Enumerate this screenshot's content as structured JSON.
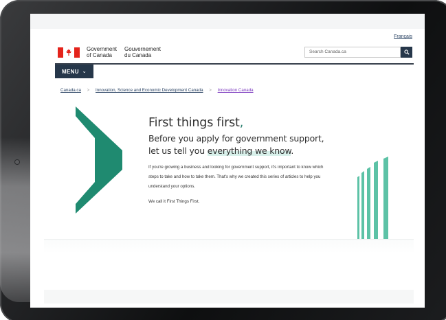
{
  "header": {
    "language_link": "Français",
    "brand_en_line1": "Government",
    "brand_en_line2": "of Canada",
    "brand_fr_line1": "Gouvernement",
    "brand_fr_line2": "du Canada",
    "search_placeholder": "Search Canada.ca",
    "menu_label": "MENU"
  },
  "breadcrumb": [
    "Canada.ca",
    "Innovation, Science and Economic Development Canada",
    "Innovation Canada"
  ],
  "hero": {
    "title": "First things first",
    "title_punct": ",",
    "subtitle_line1": "Before you apply for government support,",
    "subtitle_line2_prefix": "let us tell you ",
    "subtitle_line2_highlight": "everything we know",
    "subtitle_line2_suffix": ".",
    "body": "If you're growing a business and looking for government support, it's important to know which steps to take and how to take them. That's why we created this series of articles to help you understand your options.",
    "call_line": "We call it First Things First."
  },
  "colors": {
    "accent_teal": "#1f8a70",
    "bar_teal": "#5cc2a6",
    "navy": "#26374a",
    "flag_red": "#e4231b",
    "link": "#284162",
    "visited_link": "#7834bc"
  },
  "icons": {
    "search": "search-icon",
    "menu_chevron": "chevron-down-icon",
    "flag": "canada-flag-icon"
  }
}
